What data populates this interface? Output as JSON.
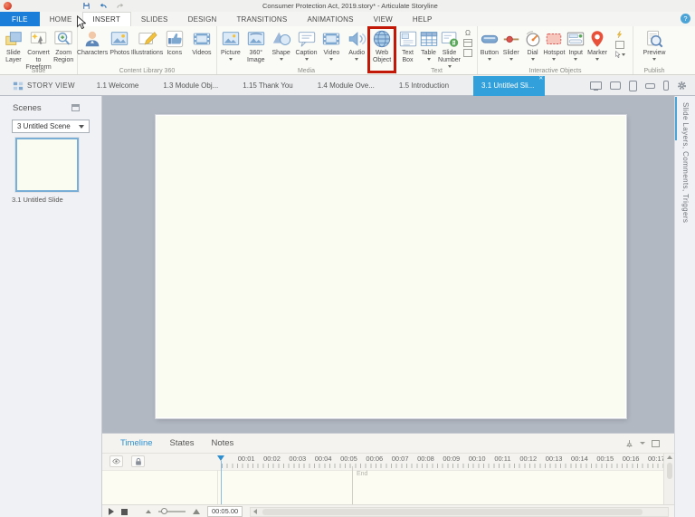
{
  "titlebar": {
    "title": "Consumer Protection Act, 2019.story* - Articulate Storyline"
  },
  "menu": {
    "tabs": [
      "FILE",
      "HOME",
      "INSERT",
      "SLIDES",
      "DESIGN",
      "TRANSITIONS",
      "ANIMATIONS",
      "VIEW",
      "HELP"
    ],
    "active_tab": "INSERT",
    "help_glyph": "?"
  },
  "ribbon": {
    "omega_symbol": "Ω",
    "highlight_color": "#c21807",
    "groups": [
      {
        "label": "Slide",
        "buttons": [
          {
            "label": "Slide Layer",
            "icon": "slide-layer-icon"
          },
          {
            "label": "Convert to Freeform",
            "icon": "freeform-icon"
          },
          {
            "label": "Zoom Region",
            "icon": "zoom-region-icon"
          }
        ]
      },
      {
        "label": "Content Library 360",
        "buttons": [
          {
            "label": "Characters",
            "icon": "character-icon"
          },
          {
            "label": "Photos",
            "icon": "photo-icon"
          },
          {
            "label": "Illustrations",
            "icon": "illustration-icon"
          },
          {
            "label": "Icons",
            "icon": "thumb-up-icon"
          },
          {
            "label": "Videos",
            "icon": "film-icon"
          }
        ]
      },
      {
        "label": "Media",
        "buttons": [
          {
            "label": "Picture",
            "icon": "picture-icon",
            "dropdown": true
          },
          {
            "label": "360° Image",
            "icon": "image-360-icon"
          },
          {
            "label": "Shape",
            "icon": "shape-icon",
            "dropdown": true
          },
          {
            "label": "Caption",
            "icon": "caption-icon",
            "dropdown": true
          },
          {
            "label": "Video",
            "icon": "video-icon",
            "dropdown": true
          },
          {
            "label": "Audio",
            "icon": "speaker-icon",
            "dropdown": true
          },
          {
            "label": "Web Object",
            "icon": "globe-icon",
            "highlighted": true
          }
        ]
      },
      {
        "label": "Text",
        "buttons": [
          {
            "label": "Text Box",
            "icon": "text-box-icon"
          },
          {
            "label": "Table",
            "icon": "table-icon",
            "dropdown": true
          },
          {
            "label": "Slide Number",
            "icon": "slide-number-icon",
            "dropdown": true
          }
        ]
      },
      {
        "label": "Interactive Objects",
        "buttons": [
          {
            "label": "Button",
            "icon": "button-icon",
            "dropdown": true
          },
          {
            "label": "Slider",
            "icon": "slider-icon",
            "dropdown": true
          },
          {
            "label": "Dial",
            "icon": "dial-icon",
            "dropdown": true
          },
          {
            "label": "Hotspot",
            "icon": "hotspot-icon",
            "dropdown": true
          },
          {
            "label": "Input",
            "icon": "input-icon",
            "dropdown": true
          },
          {
            "label": "Marker",
            "icon": "marker-icon",
            "dropdown": true
          }
        ]
      },
      {
        "label": "Publish",
        "buttons": [
          {
            "label": "Preview",
            "icon": "preview-magnifier-icon",
            "dropdown": true
          }
        ]
      }
    ]
  },
  "slide_tabs": {
    "story_view": "STORY VIEW",
    "tabs": [
      "1.1 Welcome",
      "1.3 Module Obj...",
      "1.15 Thank You",
      "1.4 Module Ove...",
      "1.5 Introduction"
    ],
    "active_tab": "3.1 Untitled Sli...",
    "close_glyph": "✕"
  },
  "scenes_panel": {
    "title": "Scenes",
    "scene_selector_value": "3 Untitled Scene",
    "slide_thumbnail_label": "3.1 Untitled Slide"
  },
  "right_panel": {
    "vertical_label": "Slide Layers, Comments, Triggers"
  },
  "timeline": {
    "tabs": [
      "Timeline",
      "States",
      "Notes"
    ],
    "active_tab": "Timeline",
    "ruler_ticks": [
      "00:01",
      "00:02",
      "00:03",
      "00:04",
      "00:05",
      "00:06",
      "00:07",
      "00:08",
      "00:09",
      "00:10",
      "00:11",
      "00:12",
      "00:13",
      "00:14",
      "00:15",
      "00:16",
      "00:17"
    ],
    "end_marker_label": "End",
    "duration_value": "00:05.00"
  },
  "colors": {
    "accent_blue": "#2e8fd0",
    "file_tab_blue": "#1b7fd9",
    "active_slide_tab_blue": "#31a0db",
    "highlight_red": "#c21807",
    "stage_gray": "#b2b8c2",
    "canvas_cream": "#fbfcf1"
  }
}
